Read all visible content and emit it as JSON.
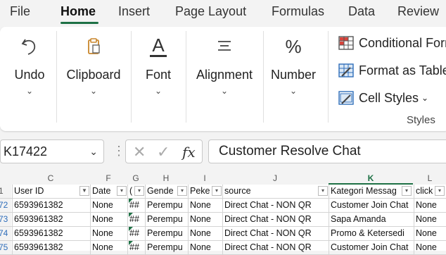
{
  "ribbon_tabs": [
    "File",
    "Home",
    "Insert",
    "Page Layout",
    "Formulas",
    "Data",
    "Review"
  ],
  "active_tab": "Home",
  "ribbon": {
    "undo_label": "Undo",
    "clipboard_label": "Clipboard",
    "font_label": "Font",
    "alignment_label": "Alignment",
    "number_label": "Number",
    "conditional_formatting": "Conditional Forr",
    "format_as_table": "Format as Table",
    "cell_styles": "Cell Styles",
    "styles_group": "Styles",
    "number_icon": "%",
    "font_icon": "A"
  },
  "formula_bar": {
    "name_box": "K17422",
    "content": "Customer Resolve Chat",
    "fx": "fx"
  },
  "columns": [
    "C",
    "F",
    "G",
    "H",
    "I",
    "J",
    "K",
    "L"
  ],
  "selected_column": "K",
  "header_row": {
    "row_num": "1",
    "cells": [
      "User ID",
      "Date",
      "(",
      "Gende",
      "Peke",
      "source",
      "Kategori Messag",
      "click"
    ]
  },
  "rows": [
    {
      "row_num": "72",
      "cells": [
        "6593961382",
        "None",
        "##",
        "Perempu",
        "None",
        "Direct Chat - NON QR",
        "Customer Join Chat",
        "None"
      ]
    },
    {
      "row_num": "73",
      "cells": [
        "6593961382",
        "None",
        "##",
        "Perempu",
        "None",
        "Direct Chat - NON QR",
        "Sapa Amanda",
        "None"
      ]
    },
    {
      "row_num": "74",
      "cells": [
        "6593961382",
        "None",
        "##",
        "Perempu",
        "None",
        "Direct Chat - NON QR",
        "Promo & Ketersedi",
        "None"
      ]
    },
    {
      "row_num": "75",
      "cells": [
        "6593961382",
        "None",
        "##",
        "Perempu",
        "None",
        "Direct Chat - NON QR",
        "Customer Join Chat",
        "None"
      ]
    }
  ],
  "colors": {
    "accent": "#1e7145",
    "row_number": "#2f6eba"
  }
}
